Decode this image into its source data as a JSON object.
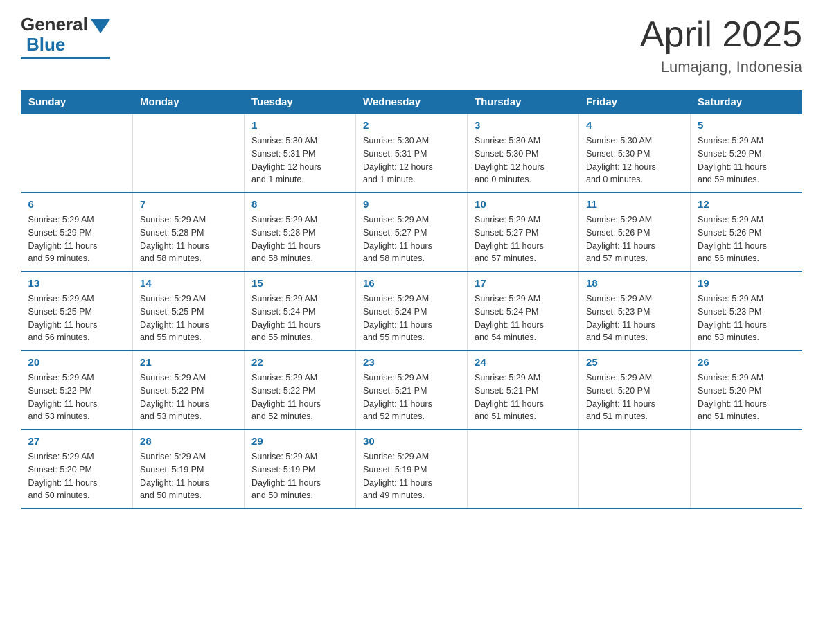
{
  "logo": {
    "general": "General",
    "blue": "Blue"
  },
  "title": "April 2025",
  "subtitle": "Lumajang, Indonesia",
  "header": {
    "days": [
      "Sunday",
      "Monday",
      "Tuesday",
      "Wednesday",
      "Thursday",
      "Friday",
      "Saturday"
    ]
  },
  "weeks": [
    [
      {
        "day": "",
        "info": ""
      },
      {
        "day": "",
        "info": ""
      },
      {
        "day": "1",
        "info": "Sunrise: 5:30 AM\nSunset: 5:31 PM\nDaylight: 12 hours\nand 1 minute."
      },
      {
        "day": "2",
        "info": "Sunrise: 5:30 AM\nSunset: 5:31 PM\nDaylight: 12 hours\nand 1 minute."
      },
      {
        "day": "3",
        "info": "Sunrise: 5:30 AM\nSunset: 5:30 PM\nDaylight: 12 hours\nand 0 minutes."
      },
      {
        "day": "4",
        "info": "Sunrise: 5:30 AM\nSunset: 5:30 PM\nDaylight: 12 hours\nand 0 minutes."
      },
      {
        "day": "5",
        "info": "Sunrise: 5:29 AM\nSunset: 5:29 PM\nDaylight: 11 hours\nand 59 minutes."
      }
    ],
    [
      {
        "day": "6",
        "info": "Sunrise: 5:29 AM\nSunset: 5:29 PM\nDaylight: 11 hours\nand 59 minutes."
      },
      {
        "day": "7",
        "info": "Sunrise: 5:29 AM\nSunset: 5:28 PM\nDaylight: 11 hours\nand 58 minutes."
      },
      {
        "day": "8",
        "info": "Sunrise: 5:29 AM\nSunset: 5:28 PM\nDaylight: 11 hours\nand 58 minutes."
      },
      {
        "day": "9",
        "info": "Sunrise: 5:29 AM\nSunset: 5:27 PM\nDaylight: 11 hours\nand 58 minutes."
      },
      {
        "day": "10",
        "info": "Sunrise: 5:29 AM\nSunset: 5:27 PM\nDaylight: 11 hours\nand 57 minutes."
      },
      {
        "day": "11",
        "info": "Sunrise: 5:29 AM\nSunset: 5:26 PM\nDaylight: 11 hours\nand 57 minutes."
      },
      {
        "day": "12",
        "info": "Sunrise: 5:29 AM\nSunset: 5:26 PM\nDaylight: 11 hours\nand 56 minutes."
      }
    ],
    [
      {
        "day": "13",
        "info": "Sunrise: 5:29 AM\nSunset: 5:25 PM\nDaylight: 11 hours\nand 56 minutes."
      },
      {
        "day": "14",
        "info": "Sunrise: 5:29 AM\nSunset: 5:25 PM\nDaylight: 11 hours\nand 55 minutes."
      },
      {
        "day": "15",
        "info": "Sunrise: 5:29 AM\nSunset: 5:24 PM\nDaylight: 11 hours\nand 55 minutes."
      },
      {
        "day": "16",
        "info": "Sunrise: 5:29 AM\nSunset: 5:24 PM\nDaylight: 11 hours\nand 55 minutes."
      },
      {
        "day": "17",
        "info": "Sunrise: 5:29 AM\nSunset: 5:24 PM\nDaylight: 11 hours\nand 54 minutes."
      },
      {
        "day": "18",
        "info": "Sunrise: 5:29 AM\nSunset: 5:23 PM\nDaylight: 11 hours\nand 54 minutes."
      },
      {
        "day": "19",
        "info": "Sunrise: 5:29 AM\nSunset: 5:23 PM\nDaylight: 11 hours\nand 53 minutes."
      }
    ],
    [
      {
        "day": "20",
        "info": "Sunrise: 5:29 AM\nSunset: 5:22 PM\nDaylight: 11 hours\nand 53 minutes."
      },
      {
        "day": "21",
        "info": "Sunrise: 5:29 AM\nSunset: 5:22 PM\nDaylight: 11 hours\nand 53 minutes."
      },
      {
        "day": "22",
        "info": "Sunrise: 5:29 AM\nSunset: 5:22 PM\nDaylight: 11 hours\nand 52 minutes."
      },
      {
        "day": "23",
        "info": "Sunrise: 5:29 AM\nSunset: 5:21 PM\nDaylight: 11 hours\nand 52 minutes."
      },
      {
        "day": "24",
        "info": "Sunrise: 5:29 AM\nSunset: 5:21 PM\nDaylight: 11 hours\nand 51 minutes."
      },
      {
        "day": "25",
        "info": "Sunrise: 5:29 AM\nSunset: 5:20 PM\nDaylight: 11 hours\nand 51 minutes."
      },
      {
        "day": "26",
        "info": "Sunrise: 5:29 AM\nSunset: 5:20 PM\nDaylight: 11 hours\nand 51 minutes."
      }
    ],
    [
      {
        "day": "27",
        "info": "Sunrise: 5:29 AM\nSunset: 5:20 PM\nDaylight: 11 hours\nand 50 minutes."
      },
      {
        "day": "28",
        "info": "Sunrise: 5:29 AM\nSunset: 5:19 PM\nDaylight: 11 hours\nand 50 minutes."
      },
      {
        "day": "29",
        "info": "Sunrise: 5:29 AM\nSunset: 5:19 PM\nDaylight: 11 hours\nand 50 minutes."
      },
      {
        "day": "30",
        "info": "Sunrise: 5:29 AM\nSunset: 5:19 PM\nDaylight: 11 hours\nand 49 minutes."
      },
      {
        "day": "",
        "info": ""
      },
      {
        "day": "",
        "info": ""
      },
      {
        "day": "",
        "info": ""
      }
    ]
  ]
}
